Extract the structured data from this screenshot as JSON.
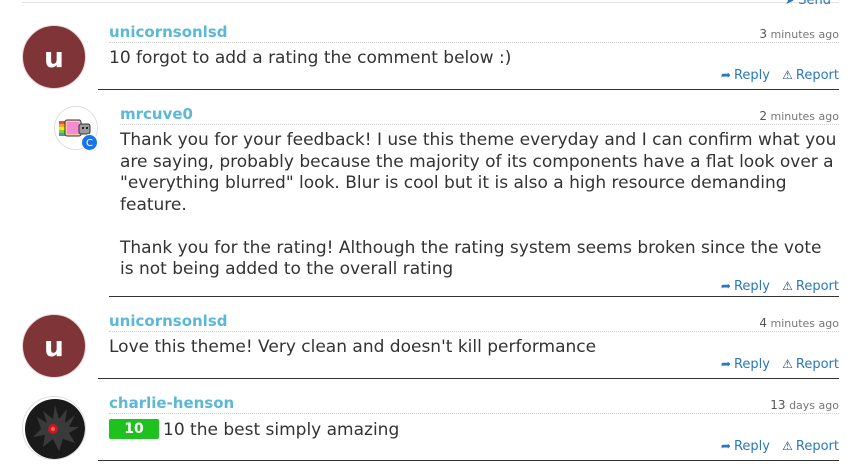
{
  "top": {
    "send_label": "Send"
  },
  "comments": [
    {
      "avatar_letter": "u",
      "username": "unicornsonlsd",
      "time_num": "3",
      "time_unit": "minutes ago",
      "text": "10 forgot to add a rating the comment below :)",
      "reply_label": "Reply",
      "report_label": "Report"
    },
    {
      "badge": "C",
      "username": "mrcuve0",
      "time_num": "2",
      "time_unit": "minutes ago",
      "paragraphs": [
        "Thank you for your feedback! I use this theme everyday and I can confirm what you are saying, probably because the majority of its components have a flat look over a \"everything blurred\" look. Blur is cool but it is also a high resource demanding feature.",
        "Thank you for the rating! Although the rating system seems broken since the vote is not being added to the overall rating"
      ],
      "reply_label": "Reply",
      "report_label": "Report"
    },
    {
      "avatar_letter": "u",
      "username": "unicornsonlsd",
      "time_num": "4",
      "time_unit": "minutes ago",
      "text": "Love this theme! Very clean and doesn't kill performance",
      "reply_label": "Reply",
      "report_label": "Report"
    },
    {
      "username": "charlie-henson",
      "time_num": "13",
      "time_unit": "days ago",
      "rating": "10",
      "text": "10 the best simply amazing",
      "reply_label": "Reply",
      "report_label": "Report"
    }
  ],
  "icons": {
    "reply": "reply-icon",
    "report": "warning-icon",
    "send": "send-icon"
  },
  "colors": {
    "username": "#5bb8d6",
    "link": "#2a78b8",
    "avatar_bg": "#7f3438",
    "rating": "#1fc11f"
  }
}
